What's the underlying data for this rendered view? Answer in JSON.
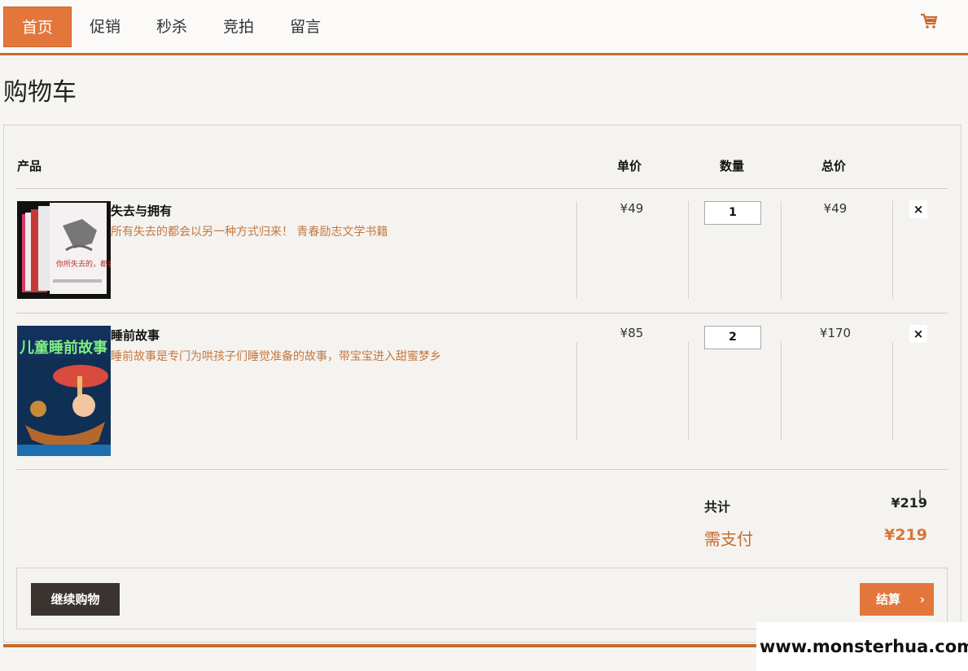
{
  "nav": {
    "items": [
      "首页",
      "促销",
      "秒杀",
      "竞拍",
      "留言"
    ],
    "active_index": 0
  },
  "page_title": "购物车",
  "table_headers": {
    "product": "产品",
    "unit_price": "单价",
    "quantity": "数量",
    "total": "总价"
  },
  "items": [
    {
      "name": "失去与拥有",
      "description": "所有失去的都会以另一种方式归来！ 青春励志文学书籍",
      "unit_price": "¥49",
      "quantity": "1",
      "total": "¥49",
      "remove": "×",
      "cover_text": "你所失去的，都会以另一种方式归来"
    },
    {
      "name": "睡前故事",
      "description": "睡前故事是专门为哄孩子们睡觉准备的故事，带宝宝进入甜蜜梦乡",
      "unit_price": "¥85",
      "quantity": "2",
      "total": "¥170",
      "remove": "×",
      "cover_text": "儿童睡前故事"
    }
  ],
  "summary": {
    "subtotal_label": "共计",
    "subtotal_value": "¥219",
    "payable_label": "需支付",
    "payable_value": "¥219"
  },
  "buttons": {
    "continue": "继续购物",
    "checkout": "结算",
    "checkout_chevron": "›"
  },
  "watermark": "www.monsterhua.com",
  "icons": {
    "cart": "shopping-cart-icon",
    "remove": "close-icon",
    "chevron": "chevron-right-icon"
  },
  "colors": {
    "accent": "#e3773b",
    "accent_dark": "#c96b2e",
    "desc_text": "#c5773f",
    "dark_button": "#3a332f"
  }
}
